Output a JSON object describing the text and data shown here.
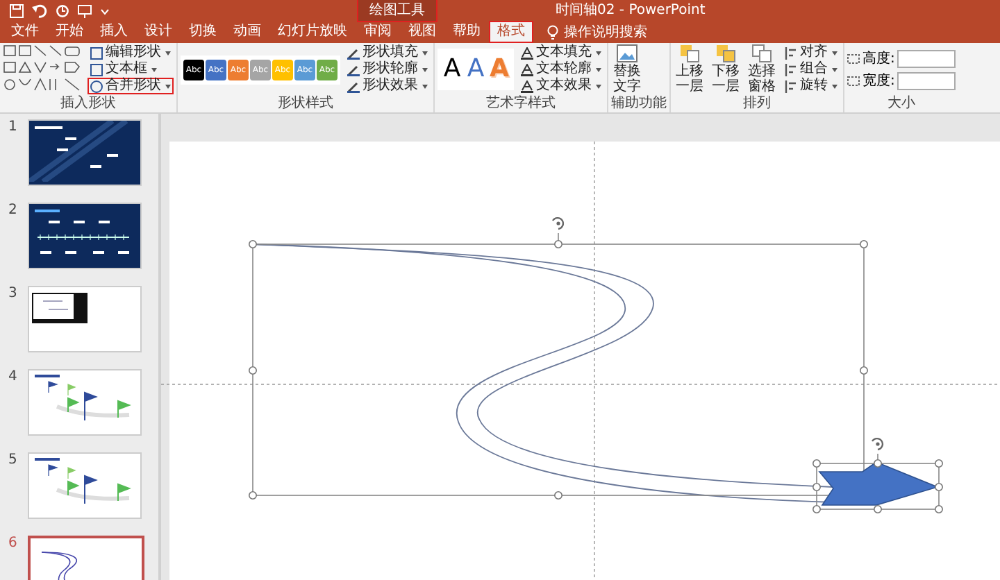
{
  "title_bar": {
    "context_label": "绘图工具",
    "context_highlighted": true,
    "title": "时间轴02 - PowerPoint"
  },
  "tabs": [
    {
      "label": "文件",
      "selected": false,
      "highlighted": false
    },
    {
      "label": "开始",
      "selected": false,
      "highlighted": false
    },
    {
      "label": "插入",
      "selected": false,
      "highlighted": false
    },
    {
      "label": "设计",
      "selected": false,
      "highlighted": false
    },
    {
      "label": "切换",
      "selected": false,
      "highlighted": false
    },
    {
      "label": "动画",
      "selected": false,
      "highlighted": false
    },
    {
      "label": "幻灯片放映",
      "selected": false,
      "highlighted": false
    },
    {
      "label": "审阅",
      "selected": false,
      "highlighted": false
    },
    {
      "label": "视图",
      "selected": false,
      "highlighted": false
    },
    {
      "label": "帮助",
      "selected": false,
      "highlighted": false
    },
    {
      "label": "格式",
      "selected": true,
      "highlighted": true
    }
  ],
  "tell_me": "操作说明搜索",
  "insert_shapes": {
    "label": "插入形状",
    "buttons": [
      {
        "label": "编辑形状",
        "highlighted": false
      },
      {
        "label": "文本框",
        "highlighted": false
      },
      {
        "label": "合并形状",
        "highlighted": true
      }
    ]
  },
  "shape_styles": {
    "label": "形状样式",
    "swatches": [
      {
        "text": "Abc",
        "color": "#000000"
      },
      {
        "text": "Abc",
        "color": "#4472c4"
      },
      {
        "text": "Abc",
        "color": "#ed7d31"
      },
      {
        "text": "Abc",
        "color": "#a5a5a5"
      },
      {
        "text": "Abc",
        "color": "#ffc000"
      },
      {
        "text": "Abc",
        "color": "#5b9bd5"
      },
      {
        "text": "Abc",
        "color": "#70ad47"
      }
    ],
    "buttons": [
      "形状填充",
      "形状轮廓",
      "形状效果"
    ]
  },
  "wordart_styles": {
    "label": "艺术字样式",
    "samples": [
      {
        "text": "A",
        "kind": "fill",
        "color": "#000000"
      },
      {
        "text": "A",
        "kind": "fill",
        "color": "#4472c4"
      },
      {
        "text": "A",
        "kind": "outline",
        "color": "#ed7d31"
      }
    ],
    "buttons": [
      "文本填充",
      "文本轮廓",
      "文本效果"
    ]
  },
  "accessibility": {
    "label": "辅助功能",
    "button": "替换文字"
  },
  "arrange": {
    "label": "排列",
    "large_buttons": [
      "上移一层",
      "下移一层",
      "选择窗格"
    ],
    "small_buttons": [
      "对齐",
      "组合",
      "旋转"
    ]
  },
  "size": {
    "label": "大小",
    "fields": [
      {
        "label": "高度:"
      },
      {
        "label": "宽度:"
      }
    ]
  },
  "slides": [
    {
      "number": "1",
      "kind": "dark",
      "selected": false
    },
    {
      "number": "2",
      "kind": "dark-ruler",
      "selected": false
    },
    {
      "number": "3",
      "kind": "inset",
      "selected": false
    },
    {
      "number": "4",
      "kind": "flags",
      "selected": false
    },
    {
      "number": "5",
      "kind": "flags",
      "selected": false
    },
    {
      "number": "6",
      "kind": "curve",
      "selected": true
    }
  ]
}
